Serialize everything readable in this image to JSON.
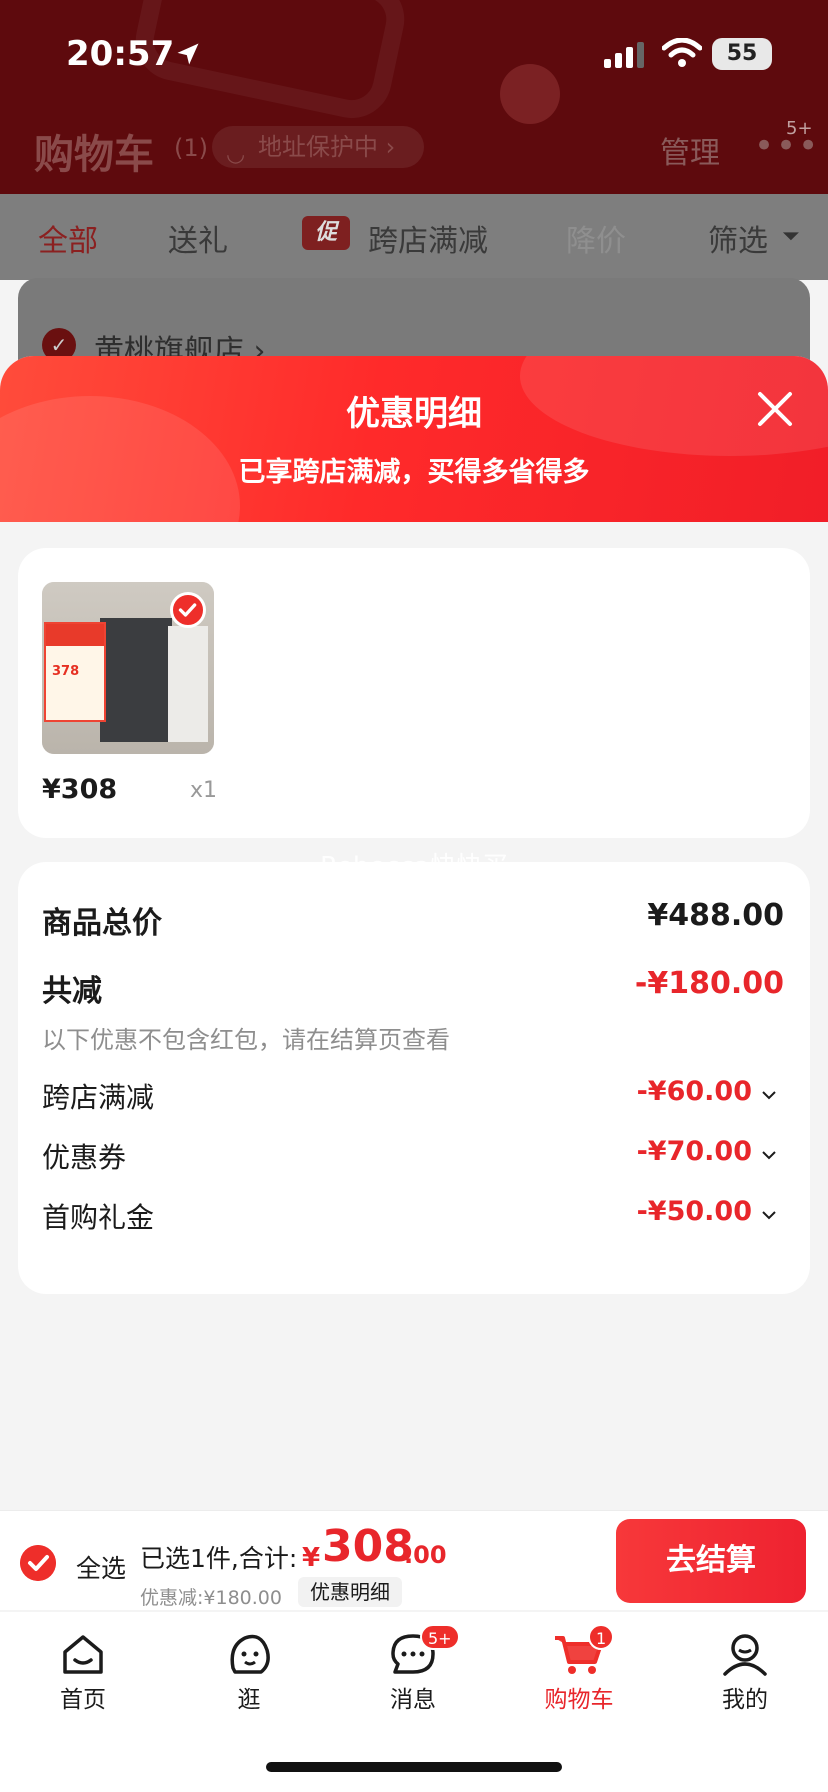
{
  "status_bar": {
    "time": "20:57",
    "battery": "55"
  },
  "cart_header": {
    "title": "购物车",
    "count": "(1)",
    "address_protect": "地址保护中",
    "manage": "管理",
    "more_badge": "5+"
  },
  "filter_tabs": {
    "all": "全部",
    "gift": "送礼",
    "promo_tag": "促",
    "cross_store": "跨店满减",
    "price_drop": "降价",
    "filter": "筛选"
  },
  "store": {
    "name": "黄桃旗舰店"
  },
  "sheet": {
    "title": "优惠明细",
    "subtitle": "已享跨店满减，买得多省得多"
  },
  "product": {
    "price": "¥308",
    "quantity": "x1",
    "poster_price": "378"
  },
  "watermark": "Rebecca快快买",
  "summary": {
    "total_label": "商品总价",
    "total_amount": "¥488.00",
    "reduce_label": "共减",
    "reduce_amount": "-¥180.00",
    "note": "以下优惠不包含红包，请在结算页查看",
    "lines": [
      {
        "label": "跨店满减",
        "amount": "-¥60.00"
      },
      {
        "label": "优惠券",
        "amount": "-¥70.00"
      },
      {
        "label": "首购礼金",
        "amount": "-¥50.00"
      }
    ]
  },
  "checkout": {
    "select_all": "全选",
    "selected_text": "已选1件,合计:",
    "currency": "¥",
    "total_main": "308",
    "total_decimal": ".00",
    "discount_text": "优惠减:¥180.00",
    "discount_detail": "优惠明细",
    "button": "去结算"
  },
  "tabbar": {
    "items": [
      {
        "label": "首页",
        "icon": "home-icon"
      },
      {
        "label": "逛",
        "icon": "browse-icon"
      },
      {
        "label": "消息",
        "icon": "message-icon",
        "badge": "5+"
      },
      {
        "label": "购物车",
        "icon": "cart-icon",
        "badge": "1"
      },
      {
        "label": "我的",
        "icon": "profile-icon"
      }
    ]
  },
  "colors": {
    "accent": "#e8262b",
    "header_dark": "#5e0a0d"
  }
}
